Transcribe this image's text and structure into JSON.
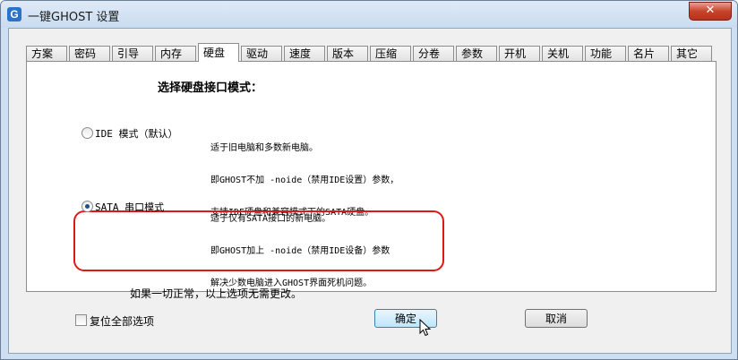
{
  "window": {
    "title": "一键GHOST 设置",
    "icon_letter": "G",
    "close_glyph": "✕"
  },
  "tabs": [
    {
      "label": "方案"
    },
    {
      "label": "密码"
    },
    {
      "label": "引导"
    },
    {
      "label": "内存"
    },
    {
      "label": "硬盘",
      "active": true
    },
    {
      "label": "驱动"
    },
    {
      "label": "速度"
    },
    {
      "label": "版本"
    },
    {
      "label": "压缩"
    },
    {
      "label": "分卷"
    },
    {
      "label": "参数"
    },
    {
      "label": "开机"
    },
    {
      "label": "关机"
    },
    {
      "label": "功能"
    },
    {
      "label": "名片"
    },
    {
      "label": "其它"
    }
  ],
  "panel": {
    "heading": "选择硬盘接口模式：",
    "options": [
      {
        "label": "IDE 模式（默认）",
        "checked": false,
        "desc": [
          "适于旧电脑和多数新电脑。",
          "即GHOST不加 -noide（禁用IDE设置）参数，",
          "支持IDE硬盘和兼容模式下的SATA硬盘。"
        ]
      },
      {
        "label": "SATA 串口模式",
        "checked": true,
        "desc": [
          "适于仅有SATA接口的新电脑。",
          "即GHOST加上 -noide（禁用IDE设备）参数",
          "解决少数电脑进入GHOST界面死机问题。"
        ]
      }
    ],
    "note": "如果一切正常，以上选项无需更改。"
  },
  "footer": {
    "reset_label": "复位全部选项",
    "ok_label": "确定",
    "cancel_label": "取消"
  },
  "colors": {
    "highlight": "#e01717",
    "title_bar": "#cddff1"
  }
}
